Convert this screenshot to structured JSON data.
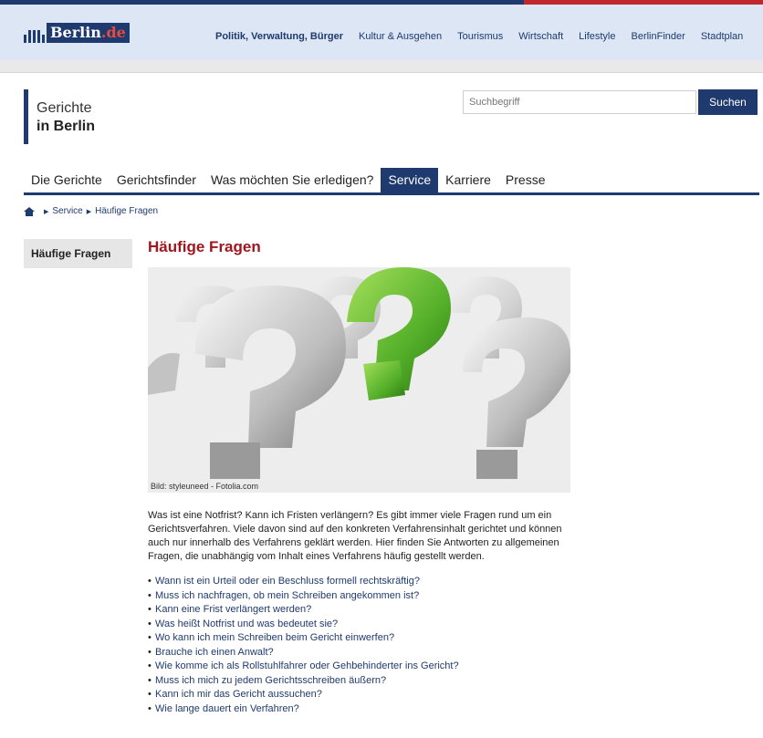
{
  "portal": {
    "logo_text": "Berlin",
    "logo_suffix": ".de",
    "nav": [
      "Politik, Verwaltung, Bürger",
      "Kultur & Ausgehen",
      "Tourismus",
      "Wirtschaft",
      "Lifestyle",
      "BerlinFinder",
      "Stadtplan"
    ]
  },
  "site": {
    "title_line1": "Gerichte",
    "title_line2": "in Berlin"
  },
  "search": {
    "placeholder": "Suchbegriff",
    "button_label": "Suchen"
  },
  "main_nav": {
    "tabs": [
      {
        "label": "Die Gerichte",
        "active": false
      },
      {
        "label": "Gerichtsfinder",
        "active": false
      },
      {
        "label": "Was möchten Sie erledigen?",
        "active": false
      },
      {
        "label": "Service",
        "active": true
      },
      {
        "label": "Karriere",
        "active": false
      },
      {
        "label": "Presse",
        "active": false
      }
    ]
  },
  "breadcrumb": {
    "items": [
      "Service",
      "Häufige Fragen"
    ]
  },
  "sidebar": {
    "items": [
      {
        "label": "Häufige Fragen"
      }
    ]
  },
  "main": {
    "title": "Häufige Fragen",
    "image_caption": "Bild: styleuneed - Fotolia.com",
    "intro": "Was ist eine Notfrist? Kann ich Fristen verlängern? Es gibt immer viele Fragen rund um ein Gerichtsverfahren. Viele davon sind auf den konkreten Verfahrensinhalt gerichtet und können auch nur innerhalb des Verfahrens geklärt werden. Hier finden Sie Antworten zu allgemeinen Fragen, die unabhängig vom Inhalt eines Verfahrens häufig gestellt werden.",
    "faq": [
      "Wann ist ein Urteil oder ein Beschluss formell rechtskräftig?",
      "Muss ich nachfragen, ob mein Schreiben angekommen ist?",
      "Kann eine Frist verlängert werden?",
      "Was heißt Notfrist und was bedeutet sie?",
      "Wo kann ich mein Schreiben beim Gericht einwerfen?",
      "Brauche ich einen Anwalt?",
      "Wie komme ich als Rollstuhlfahrer oder Gehbehinderter ins Gericht?",
      "Muss ich mich zu jedem Gerichtsschreiben äußern?",
      "Kann ich mir das Gericht aussuchen?",
      "Wie lange dauert ein Verfahren?"
    ]
  },
  "colors": {
    "brand_blue": "#1f3a6e",
    "title_red": "#a0161d",
    "accent_green": "#5cb82e"
  }
}
